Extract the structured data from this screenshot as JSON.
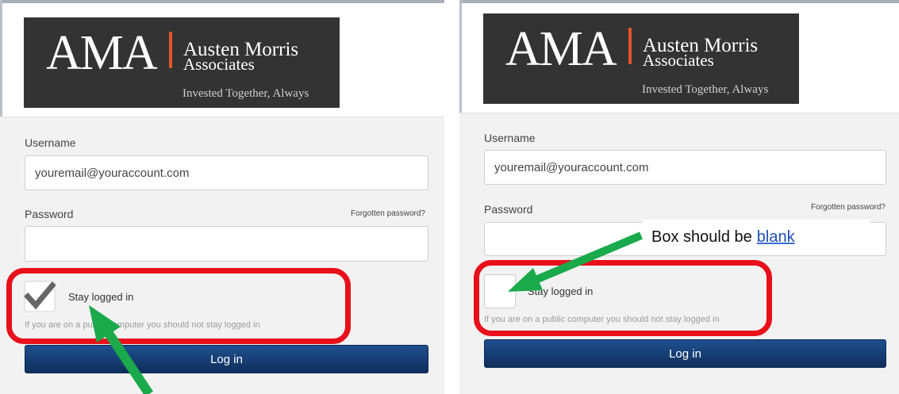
{
  "panels": [
    {
      "logo": {
        "abbr": "AMA",
        "name_line1": "Austen Morris",
        "name_line2": "Associates",
        "tagline": "Invested Together, Always"
      },
      "username_label": "Username",
      "username_value": "youremail@youraccount.com",
      "password_label": "Password",
      "forgot_link": "Forgotten password?",
      "stay_label": "Stay logged in",
      "note": "If you are on a public computer you should not stay logged in",
      "login_button": "Log in",
      "checkbox_checked": true
    },
    {
      "logo": {
        "abbr": "AMA",
        "name_line1": "Austen Morris",
        "name_line2": "Associates",
        "tagline": "Invested Together, Always"
      },
      "username_label": "Username",
      "username_value": "youremail@youraccount.com",
      "password_label": "Password",
      "forgot_link": "Forgotten password?",
      "stay_label": "Stay logged in",
      "note": "If you are on a public computer you should not stay logged in",
      "login_button": "Log in",
      "checkbox_checked": false
    }
  ],
  "annotation": {
    "callout_text": "Box should be",
    "callout_emphasis": "blank"
  },
  "colors": {
    "highlight": "#e8101a",
    "arrow": "#1aa94b",
    "button": "#1f4f8f",
    "logo_bg": "#333333",
    "logo_accent": "#e2552a"
  },
  "icons": {
    "checkmark": "check-icon",
    "arrow": "arrow-icon"
  }
}
